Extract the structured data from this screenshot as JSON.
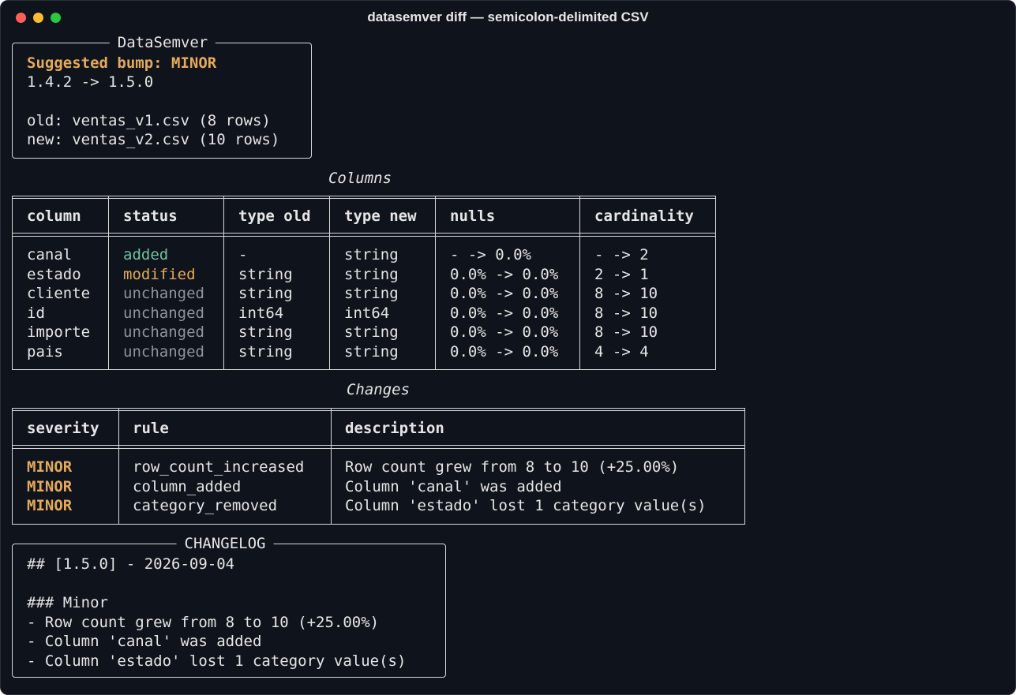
{
  "window": {
    "title": "datasemver diff — semicolon-delimited CSV"
  },
  "summary": {
    "title": "DataSemver",
    "bump": "Suggested bump: MINOR",
    "versions": "1.4.2 -> 1.5.0",
    "old": "old: ventas_v1.csv (8 rows)",
    "new": "new: ventas_v2.csv (10 rows)"
  },
  "columns_table": {
    "caption": "Columns",
    "headers": [
      "column",
      "status",
      "type old",
      "type new",
      "nulls",
      "cardinality"
    ],
    "rows": [
      {
        "column": "canal",
        "status": "added",
        "type_old": "-",
        "type_new": "string",
        "nulls": "- -> 0.0%",
        "cardinality": "- -> 2"
      },
      {
        "column": "estado",
        "status": "modified",
        "type_old": "string",
        "type_new": "string",
        "nulls": "0.0% -> 0.0%",
        "cardinality": "2 -> 1"
      },
      {
        "column": "cliente",
        "status": "unchanged",
        "type_old": "string",
        "type_new": "string",
        "nulls": "0.0% -> 0.0%",
        "cardinality": "8 -> 10"
      },
      {
        "column": "id",
        "status": "unchanged",
        "type_old": "int64",
        "type_new": "int64",
        "nulls": "0.0% -> 0.0%",
        "cardinality": "8 -> 10"
      },
      {
        "column": "importe",
        "status": "unchanged",
        "type_old": "string",
        "type_new": "string",
        "nulls": "0.0% -> 0.0%",
        "cardinality": "8 -> 10"
      },
      {
        "column": "pais",
        "status": "unchanged",
        "type_old": "string",
        "type_new": "string",
        "nulls": "0.0% -> 0.0%",
        "cardinality": "4 -> 4"
      }
    ]
  },
  "changes_table": {
    "caption": "Changes",
    "headers": [
      "severity",
      "rule",
      "description"
    ],
    "rows": [
      {
        "severity": "MINOR",
        "rule": "row_count_increased",
        "description": "Row count grew from 8 to 10 (+25.00%)"
      },
      {
        "severity": "MINOR",
        "rule": "column_added",
        "description": "Column 'canal' was added"
      },
      {
        "severity": "MINOR",
        "rule": "category_removed",
        "description": "Column 'estado' lost 1 category value(s)"
      }
    ]
  },
  "changelog": {
    "title": "CHANGELOG",
    "lines": [
      "## [1.5.0] - 2026-09-04",
      "",
      "### Minor",
      "- Row count grew from 8 to 10 (+25.00%)",
      "- Column 'canal' was added",
      "- Column 'estado' lost 1 category value(s)"
    ]
  },
  "colors": {
    "background": "#0f131b",
    "text": "#e6e6e6",
    "minor": "#e4a95a",
    "added": "#6fc2a0",
    "modified": "#e4a95a",
    "unchanged": "#8f949c",
    "border": "#d8d8d8"
  }
}
